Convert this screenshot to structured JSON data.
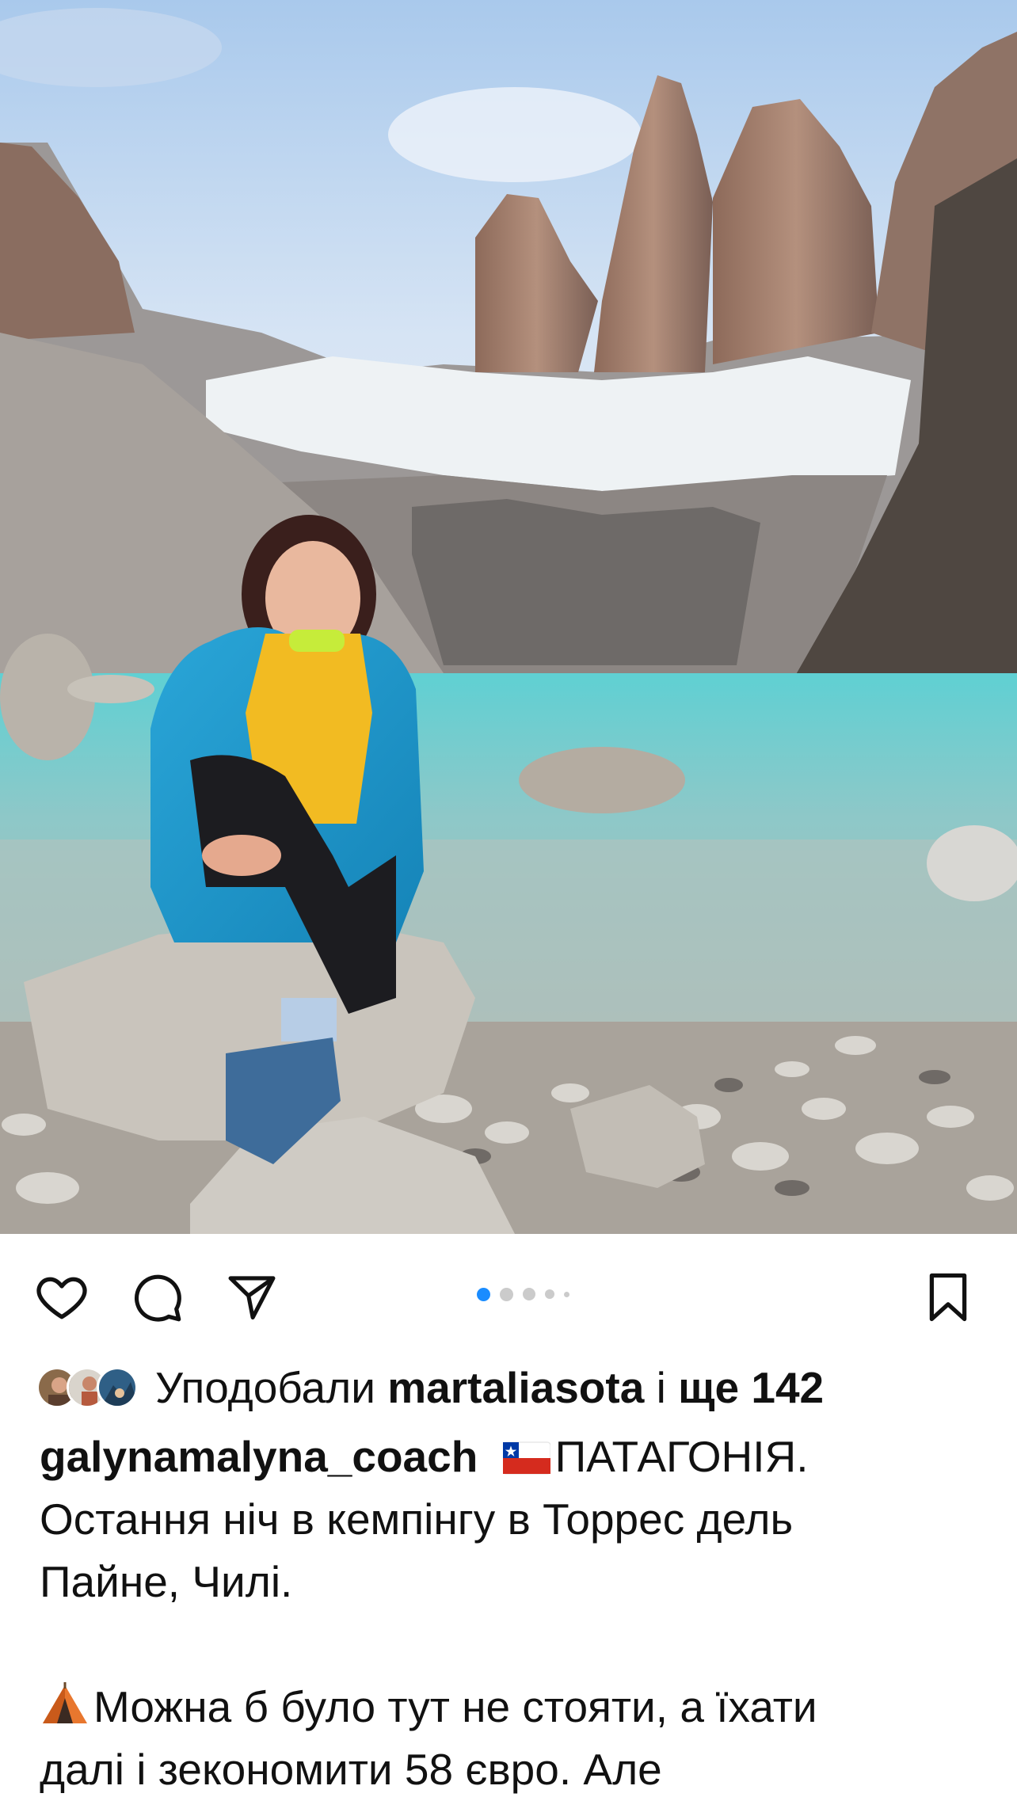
{
  "post": {
    "photo_label": "post-photo",
    "carousel": {
      "count": 5,
      "active_index": 0
    }
  },
  "actions": {
    "like_icon": "heart-icon",
    "comment_icon": "comment-icon",
    "share_icon": "send-icon",
    "save_icon": "bookmark-icon"
  },
  "likes": {
    "prefix": "Уподобали",
    "user": "martaliasota",
    "joiner": "і",
    "more": "ще 142"
  },
  "caption": {
    "username": "galynamalyna_coach",
    "flag_icon": "chile-flag-icon",
    "line1": "ПАТАГОНІЯ.",
    "line2": "Остання ніч в кемпінгу в Торрес дель",
    "line3": "Пайне, Чилі.",
    "tent_icon": "tent-icon",
    "line4": "Можна б було тут не стояти, а їхати",
    "line5": "далі і зекономити 58 євро. Але"
  },
  "colors": {
    "accent": "#1a8cff",
    "dot_inactive": "#cbcbcb",
    "text": "#111111"
  }
}
